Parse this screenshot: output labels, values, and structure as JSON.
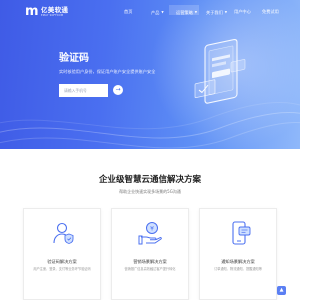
{
  "logo": {
    "title": "亿美软通",
    "subtitle": "EMAY SOFTCOM"
  },
  "nav": {
    "items": [
      {
        "label": "首页",
        "caret": false
      },
      {
        "label": "产品",
        "caret": true
      },
      {
        "label": "运营策略",
        "caret": true
      },
      {
        "label": "关于我们",
        "caret": true
      },
      {
        "label": "用户中心",
        "caret": false
      },
      {
        "label": "免费试用",
        "caret": false
      }
    ],
    "active_index": 2
  },
  "hero": {
    "title": "验证码",
    "subtitle": "实时核验用户身份，保证用户账户安全提供账户安全",
    "input_placeholder": "请输入手机号",
    "go_symbol": "→"
  },
  "section": {
    "title": "企业级智慧云通信解决方案",
    "subtitle": "帮助企业快速实现多场景的5G沟通"
  },
  "cards": [
    {
      "title": "验证码解决方案",
      "desc": "用户注册、登录、支付等业务环节验证码",
      "icon": "person-shield-icon"
    },
    {
      "title": "营销场景解决方案",
      "desc": "营销推广信息高效触达客户提升转化",
      "icon": "hand-coin-icon"
    },
    {
      "title": "通知场景解决方案",
      "desc": "订单通知、物流通知、提醒通知等",
      "icon": "phone-message-icon"
    }
  ],
  "colors": {
    "hero_start": "#3f5be6",
    "hero_end": "#8fb8fa",
    "accent": "#4b70f0"
  }
}
